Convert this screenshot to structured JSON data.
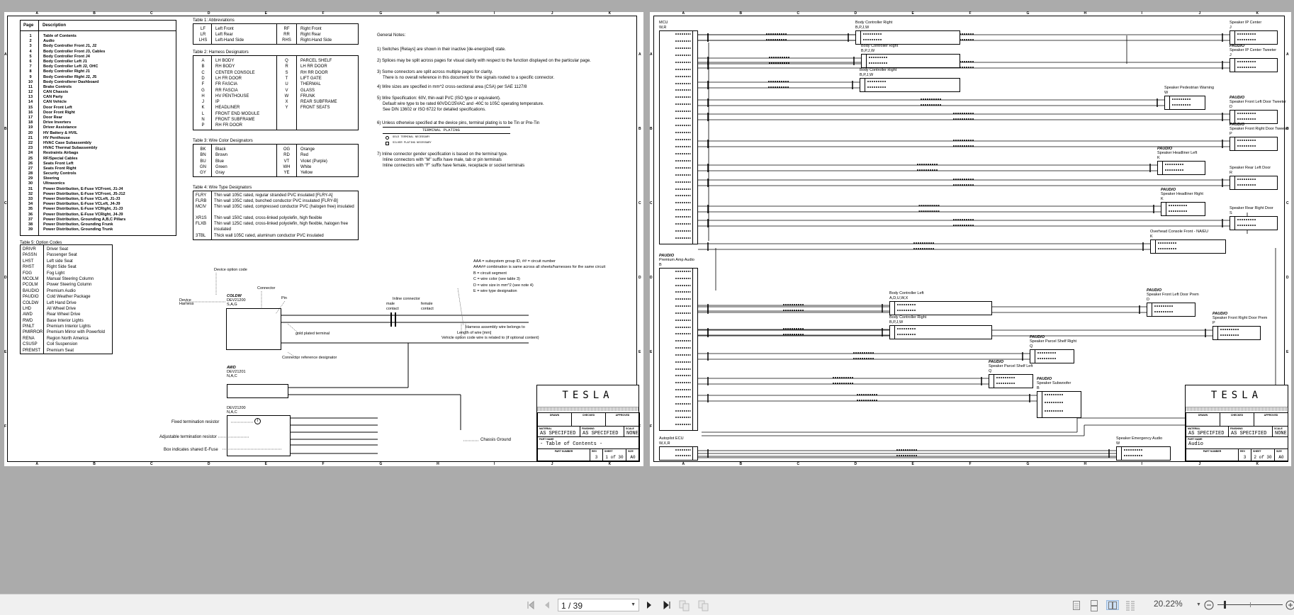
{
  "frame": {
    "columns": [
      "A",
      "B",
      "C",
      "D",
      "E",
      "F",
      "G",
      "H",
      "I",
      "J",
      "K"
    ],
    "rows": [
      "A",
      "B",
      "C",
      "D",
      "E",
      "F"
    ]
  },
  "page1": {
    "toc": {
      "header_page": "Page",
      "header_desc": "Description",
      "entries": [
        [
          "1",
          "Table of Contents"
        ],
        [
          "2",
          "Audio"
        ],
        [
          "3",
          "Body Controller Front J1, J2"
        ],
        [
          "4",
          "Body Controller Front J3, Cables"
        ],
        [
          "5",
          "Body Controller Front J4"
        ],
        [
          "6",
          "Body Controller Left J1"
        ],
        [
          "7",
          "Body Controller Left J2, OHC"
        ],
        [
          "8",
          "Body Controller Right J1"
        ],
        [
          "9",
          "Body Controller Right J2, J5"
        ],
        [
          "10",
          "Body Controllerer Dashboard"
        ],
        [
          "11",
          "Brake Controls"
        ],
        [
          "12",
          "CAN Chassis"
        ],
        [
          "13",
          "CAN Party"
        ],
        [
          "14",
          "CAN Vehicle"
        ],
        [
          "15",
          "Door Front Left"
        ],
        [
          "16",
          "Door Front Right"
        ],
        [
          "17",
          "Door Rear"
        ],
        [
          "18",
          "Drive Inverters"
        ],
        [
          "19",
          "Driver Assistance"
        ],
        [
          "20",
          "HV Battery & HVIL"
        ],
        [
          "21",
          "HV Penthouse"
        ],
        [
          "22",
          "HVAC Case Subassembly"
        ],
        [
          "23",
          "HVAC Thermal Subassembly"
        ],
        [
          "24",
          "Restraints Airbags"
        ],
        [
          "25",
          "RF/Special Cables"
        ],
        [
          "26",
          "Seats Front Left"
        ],
        [
          "27",
          "Seats Front Right"
        ],
        [
          "28",
          "Security Controls"
        ],
        [
          "29",
          "Steering"
        ],
        [
          "30",
          "Ultrasonics"
        ],
        [
          "31",
          "Power Distribution, E-Fuse VCFront, J1-J4"
        ],
        [
          "32",
          "Power Distribution, E-Fuse VCFront, J5-J12"
        ],
        [
          "33",
          "Power Distribution, E-Fuse VCLeft, J1-J3"
        ],
        [
          "34",
          "Power Distribution, E-Fuse VCLeft, J4-J9"
        ],
        [
          "35",
          "Power Distribution, E-Fuse VCRight, J1-J3"
        ],
        [
          "36",
          "Power Distribution, E-Fuse VCRight, J4-J9"
        ],
        [
          "37",
          "Power Distribution, Grounding A,B,C Pillars"
        ],
        [
          "38",
          "Power Distribution, Grounding Frunk"
        ],
        [
          "39",
          "Power Distribution, Grounding Trunk"
        ]
      ]
    },
    "table5": {
      "title": "Table 5: Option Codes",
      "entries": [
        [
          "DRIVR",
          "Driver Seat"
        ],
        [
          "PASSN",
          "Passenger Seat"
        ],
        [
          "LHST",
          "Left side Seat"
        ],
        [
          "RHST",
          "Right Side Seat"
        ],
        [
          "FOG",
          "Fog Light"
        ],
        [
          "MCOLM",
          "Manual Steering Column"
        ],
        [
          "PCOLM",
          "Power Steering Column"
        ],
        [
          "BAUDIO",
          "Premium Audio"
        ],
        [
          "PAUDIO",
          "Cold Weather Package"
        ],
        [
          "COLDW",
          "Left Hand Drive"
        ],
        [
          "LHD",
          "All Wheel Drive"
        ],
        [
          "AWD",
          "Rear Wheel Drive"
        ],
        [
          "RWD",
          "Base Interior Lights"
        ],
        [
          "PINLT",
          "Premium Interior Lights"
        ],
        [
          "PMIRROR",
          "Premium Mirror with Powerfold"
        ],
        [
          "RENA",
          "Region North America"
        ],
        [
          "CSUSP",
          "Coil Suspension"
        ],
        [
          "PREMST",
          "Premium Seat"
        ]
      ]
    },
    "table1": {
      "title": "Table 1: Abbreviations",
      "left": [
        [
          "LF",
          "Left Front"
        ],
        [
          "LR",
          "Left Rear"
        ],
        [
          "LHS",
          "Left-Hand Side"
        ]
      ],
      "right": [
        [
          "RF",
          "Right Front"
        ],
        [
          "RR",
          "Right Rear"
        ],
        [
          "RHS",
          "Right-Hand Side"
        ]
      ]
    },
    "table2": {
      "title": "Table 2: Harness Designators",
      "left": [
        [
          "A",
          "LH BODY"
        ],
        [
          "B",
          "RH BODY"
        ],
        [
          "C",
          "CENTER CONSOLE"
        ],
        [
          "D",
          "LH FR DOOR"
        ],
        [
          "F",
          "FR FASCIA"
        ],
        [
          "G",
          "RR FASCIA"
        ],
        [
          "H",
          "HV PENTHOUSE"
        ],
        [
          "J",
          "IP"
        ],
        [
          "K",
          "HEADLINER"
        ],
        [
          "L",
          "FRONT END MODULE"
        ],
        [
          "N",
          "FRONT SUBFRAME"
        ],
        [
          "P",
          "RH FR DOOR"
        ]
      ],
      "right": [
        [
          "Q",
          "PARCEL SHELF"
        ],
        [
          "R",
          "LH RR DOOR"
        ],
        [
          "S",
          "RH RR DOOR"
        ],
        [
          "T",
          "LIFT GATE"
        ],
        [
          "U",
          "THERMAL"
        ],
        [
          "V",
          "GLASS"
        ],
        [
          "W",
          "FRUNK"
        ],
        [
          "X",
          "REAR SUBFRAME"
        ],
        [
          "Y",
          "FRONT SEATS"
        ]
      ]
    },
    "table3": {
      "title": "Table 3: Wire Color Designators",
      "left": [
        [
          "BK",
          "Black"
        ],
        [
          "BN",
          "Brown"
        ],
        [
          "BU",
          "Blue"
        ],
        [
          "GN",
          "Green"
        ],
        [
          "GY",
          "Gray"
        ]
      ],
      "right": [
        [
          "OG",
          "Orange"
        ],
        [
          "RD",
          "Red"
        ],
        [
          "VT",
          "Violet (Purple)"
        ],
        [
          "WH",
          "White"
        ],
        [
          "YE",
          "Yellow"
        ]
      ]
    },
    "table4": {
      "title": "Table 4: Wire Type Designators",
      "entries": [
        [
          "FLRY",
          "Thin wall 105C rated, regular stranded PVC insulated [FLRY-A]"
        ],
        [
          "FLRB",
          "Thin wall 105C rated, bunched conductor PVC insulated [FLRY-B]"
        ],
        [
          "MCIV",
          "Thin wall 105C rated, compressed conductor PVC (halogen free) insulated"
        ],
        [
          "XR1S",
          "Thin wall 150C rated, cross-linked polyolefin, high flexible"
        ],
        [
          "FLXB",
          "Thin wall 125C rated, cross-linked polyolefin, high flexible, halogen free insulated"
        ],
        [
          "3TBL",
          "Thick wall 105C rated, aluminum conductor PVC insulated"
        ]
      ]
    },
    "notes": {
      "title": "General Notes:",
      "n1": "1) Switches [Relays] are shown in their inactive [de-energized] state.",
      "n2": "2) Splices may be split across pages for visual clarity with respect to the function displayed on the particular page.",
      "n3a": "3) Some connectors are split across multiple pages for clarity.",
      "n3b": "There is no overall reference in this document for the signals routed to a specific connector.",
      "n4": "4) Wire sizes are specified in mm^2 cross-sectional area (CSA) per SAE 1127/8",
      "n5a": "5) Wire Specification: 60V, thin-wall PVC (ISO type or equivalent).",
      "n5b": "Default wire type to be rated 60VDC/25VAC and -40C to 105C operating temperature.",
      "n5c": "See DIN 13602 or ISO 6722 for detailed specifications.",
      "n6": "6) Unless otherwise specified at the device pins, terminal plating is to be Tin or Pre-Tin",
      "plating_title": "TERMINAL PLATING",
      "plating_gold": "GOLD TERMINAL NECESSARY",
      "plating_silver": "SILVER PLATING NECESSARY",
      "n7a": "7) Inline connector gender specification is based on the terminal type.",
      "n7b": "Inline connectors with \"M\" suffix have male, tab or pin terminals",
      "n7c": "Inline connectors with \"F\" suffix have female, receptacle or socket terminals"
    },
    "legend": {
      "device_option_code": "Device option code",
      "connector": "Connector",
      "pin": "Pin",
      "device": "Device",
      "harness": "Harness",
      "dev1_option": "COLDW",
      "dev1_id": "DEV21200",
      "dev1_harness": "S,A,G",
      "inline_connector": "Inline connector",
      "male_contact": "male\ncontact",
      "male": "male",
      "female": "female",
      "contact": "contact",
      "gold_plated": "gold plated terminal",
      "conn_ref": "Connector reference designator",
      "aaa1": "AAA = subsystem group ID, ## = circuit number",
      "aaa2": "AAA## combination is same across all sheets/harnesses for the same circuit",
      "aaa3": "B = circuit segment",
      "aaa4": "C = wire color (see table 3)",
      "aaa5": "D = wire size in mm^2 (see note 4)",
      "aaa6": "E = wire type designation",
      "harness_wire": "Harness assembly wire belongs to",
      "length_wire": "Length of wire [mm]",
      "vehicle_option": "Vehicle option code wire is related to (if optional content)",
      "dev2_option": "AWD",
      "dev2_id": "DEV21201",
      "dev2_harness": "N,A,C",
      "dev3_id": "DEV21200",
      "dev3_harness": "N,A,C",
      "fixed_term": "Fixed termination resistor",
      "adj_term": "Adjustable termination resistor",
      "efuse": "Box indicates shared E-Fuse",
      "chassis_ground": "Chassis Ground"
    },
    "titleblock": {
      "logo": "TESLA",
      "drawn": "DRAWN",
      "checked": "CHECKED",
      "approved": "APPROVED",
      "material_label": "MATERIAL",
      "material": "AS SPECIFIED",
      "finishing_label": "FINISHING",
      "finishing": "AS SPECIFIED",
      "scale_label": "SCALE",
      "scale": "NONE",
      "part_name_label": "PART NAME",
      "part_name": "- Table of Contents -",
      "part_number_label": "PART NUMBER",
      "rev_label": "REV",
      "rev": "3",
      "sheet_label": "SHEET",
      "sheet": "1 of 30",
      "size_label": "SIZE",
      "size": "A0"
    }
  },
  "page2": {
    "components": [
      {
        "option": "",
        "name": "MCU",
        "code": "W,R"
      },
      {
        "option": "",
        "name": "Body Controller Right",
        "code": "B,P,J,W"
      },
      {
        "option": "",
        "name": "Body Controller Right",
        "code": "B,P,J,W"
      },
      {
        "option": "",
        "name": "Body Controller Right",
        "code": "B,P,J,W"
      },
      {
        "option": "",
        "name": "Speaker IP Center",
        "code": "J"
      },
      {
        "option": "PAUDIO",
        "name": "Speaker IP Center Tweeter",
        "code": "J"
      },
      {
        "option": "",
        "name": "Speaker Pedestrian Warning",
        "code": "W"
      },
      {
        "option": "PAUDIO",
        "name": "Speaker Front Left Door Tweeter",
        "code": "D"
      },
      {
        "option": "PAUDIO",
        "name": "Speaker Front Right Door Tweeter",
        "code": "P"
      },
      {
        "option": "PAUDIO",
        "name": "Speaker Headliner Left",
        "code": "K"
      },
      {
        "option": "",
        "name": "Speaker Rear Left Door",
        "code": "R"
      },
      {
        "option": "PAUDIO",
        "name": "Speaker Headliner Right",
        "code": "K"
      },
      {
        "option": "",
        "name": "Speaker Rear Right Door",
        "code": "S"
      },
      {
        "option": "",
        "name": "Overhead Console Front - NA/EU",
        "code": "K"
      },
      {
        "option": "PAUDIO",
        "name": "Premium Amp Audio",
        "code": "B"
      },
      {
        "option": "",
        "name": "Body Controller Left",
        "code": "A,D,U,W,X"
      },
      {
        "option": "",
        "name": "Body Controller Right",
        "code": "B,P,J,W"
      },
      {
        "option": "PAUDIO",
        "name": "Speaker Front Left Door Prem",
        "code": "D"
      },
      {
        "option": "PAUDIO",
        "name": "Speaker Front Right Door Prem",
        "code": "P"
      },
      {
        "option": "PAUDIO",
        "name": "Speaker Parcel Shelf Right",
        "code": "Q"
      },
      {
        "option": "PAUDIO",
        "name": "Speaker Parcel Shelf Left",
        "code": "Q"
      },
      {
        "option": "PAUDIO",
        "name": "Speaker Subwoofer",
        "code": "B"
      },
      {
        "option": "",
        "name": "Speaker Emergency Audio",
        "code": "W"
      },
      {
        "option": "",
        "name": "Autopilot ECU",
        "code": "W,X,R"
      }
    ],
    "titleblock": {
      "logo": "TESLA",
      "drawn": "DRAWN",
      "checked": "CHECKED",
      "approved": "APPROVED",
      "material_label": "MATERIAL",
      "material": "AS SPECIFIED",
      "finishing_label": "FINISHING",
      "finishing": "AS SPECIFIED",
      "scale_label": "SCALE",
      "scale": "NONE",
      "part_name_label": "PART NAME",
      "part_name": "Audio",
      "part_number_label": "PART NUMBER",
      "rev_label": "REV",
      "rev": "3",
      "sheet_label": "SHEET",
      "sheet": "2 of 30",
      "size_label": "SIZE",
      "size": "A0"
    }
  },
  "toolbar": {
    "page_input": "1 / 39",
    "zoom": "20.22%"
  }
}
